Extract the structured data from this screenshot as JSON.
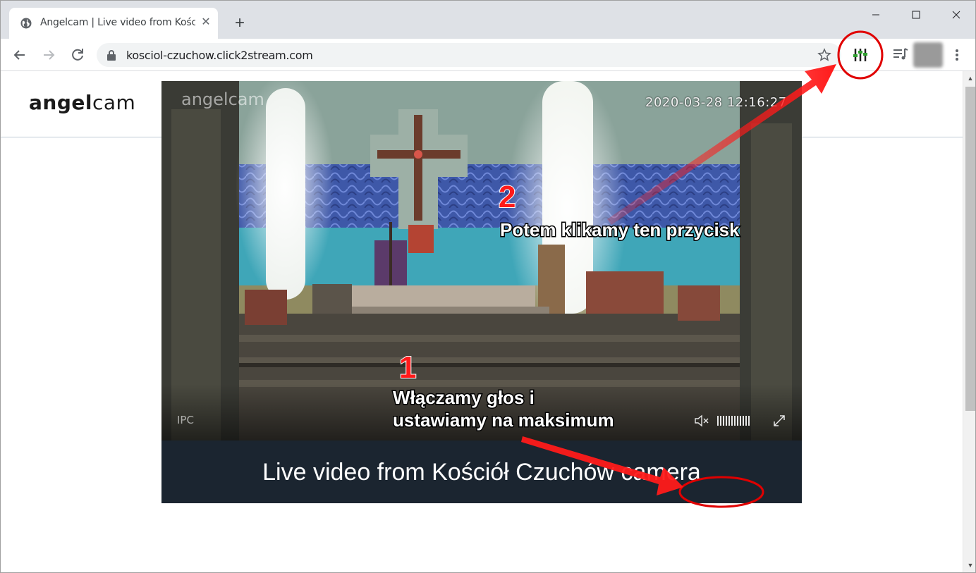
{
  "browser": {
    "tab_title": "Angelcam | Live video from Kości",
    "tab_close": "✕",
    "new_tab": "+",
    "url": "kosciol-czuchow.click2stream.com",
    "icons": [
      "globe-icon",
      "back-icon",
      "forward-icon",
      "reload-icon",
      "lock-icon",
      "star-icon",
      "equalizer-extension-icon",
      "media-control-icon",
      "kebab-menu-icon"
    ],
    "window_controls": [
      "minimize",
      "maximize",
      "close"
    ]
  },
  "site": {
    "logo_bold": "angel",
    "logo_light": "cam"
  },
  "player": {
    "watermark": "angelcam",
    "timestamp": "2020-03-28 12:16:27",
    "corner_label": "IPC",
    "volume_level": 1.0,
    "muted": true,
    "title": "Live video from Kościół Czuchów camera"
  },
  "annotations": {
    "step1_number": "1",
    "step1_line1": "Włączamy głos i",
    "step1_line2": "ustawiamy na maksimum",
    "step2_number": "2",
    "step2_text": "Potem klikamy ten przycisk",
    "color": "#ff1a1a"
  }
}
